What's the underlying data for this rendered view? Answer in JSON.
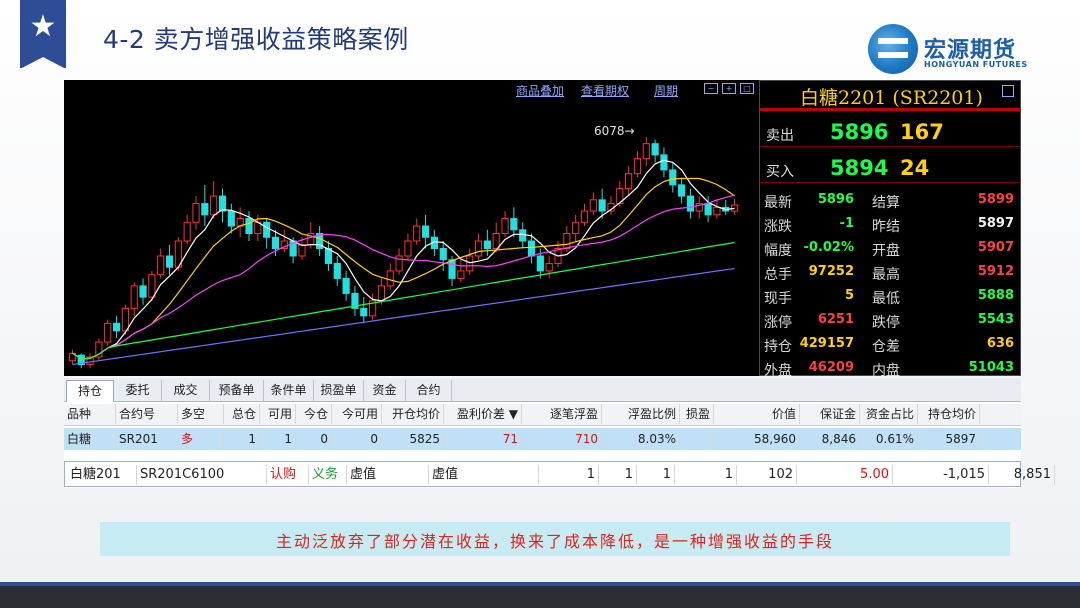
{
  "slide": {
    "title": "4-2 卖方增强收益策略案例",
    "logo_cn": "宏源期货",
    "logo_en": "HONGYUAN FUTURES",
    "note": "主动泛放弃了部分潜在收益，换来了成本降低，是一种增强收益的手段"
  },
  "toolbar": {
    "items": [
      "商品叠加",
      "查看期权",
      "周期"
    ]
  },
  "chart": {
    "peak_label": "6078→"
  },
  "chart_data": {
    "type": "candlestick",
    "annotations": [
      "6078"
    ],
    "ylim": [
      5450,
      6150
    ],
    "candles": [
      [
        5480,
        5500,
        5470,
        5510
      ],
      [
        5495,
        5470,
        5460,
        5500
      ],
      [
        5470,
        5490,
        5460,
        5500
      ],
      [
        5490,
        5530,
        5480,
        5540
      ],
      [
        5530,
        5580,
        5520,
        5590
      ],
      [
        5580,
        5560,
        5540,
        5600
      ],
      [
        5560,
        5620,
        5550,
        5630
      ],
      [
        5620,
        5680,
        5600,
        5690
      ],
      [
        5680,
        5650,
        5630,
        5700
      ],
      [
        5650,
        5710,
        5640,
        5720
      ],
      [
        5710,
        5760,
        5700,
        5780
      ],
      [
        5760,
        5730,
        5710,
        5790
      ],
      [
        5730,
        5800,
        5720,
        5810
      ],
      [
        5800,
        5850,
        5790,
        5870
      ],
      [
        5850,
        5900,
        5830,
        5920
      ],
      [
        5900,
        5870,
        5840,
        5950
      ],
      [
        5870,
        5920,
        5860,
        5960
      ],
      [
        5920,
        5880,
        5850,
        5940
      ],
      [
        5880,
        5840,
        5820,
        5900
      ],
      [
        5840,
        5860,
        5810,
        5890
      ],
      [
        5860,
        5820,
        5800,
        5880
      ],
      [
        5820,
        5850,
        5800,
        5870
      ],
      [
        5850,
        5810,
        5780,
        5860
      ],
      [
        5810,
        5780,
        5760,
        5830
      ],
      [
        5780,
        5800,
        5770,
        5830
      ],
      [
        5800,
        5760,
        5740,
        5810
      ],
      [
        5760,
        5790,
        5750,
        5810
      ],
      [
        5790,
        5820,
        5780,
        5850
      ],
      [
        5820,
        5780,
        5760,
        5840
      ],
      [
        5780,
        5740,
        5720,
        5800
      ],
      [
        5740,
        5700,
        5680,
        5760
      ],
      [
        5700,
        5660,
        5640,
        5720
      ],
      [
        5660,
        5620,
        5600,
        5680
      ],
      [
        5620,
        5600,
        5580,
        5650
      ],
      [
        5600,
        5640,
        5590,
        5660
      ],
      [
        5640,
        5680,
        5630,
        5700
      ],
      [
        5680,
        5720,
        5670,
        5740
      ],
      [
        5720,
        5760,
        5710,
        5780
      ],
      [
        5760,
        5800,
        5750,
        5820
      ],
      [
        5800,
        5840,
        5790,
        5860
      ],
      [
        5840,
        5810,
        5780,
        5870
      ],
      [
        5810,
        5780,
        5760,
        5830
      ],
      [
        5780,
        5750,
        5720,
        5800
      ],
      [
        5750,
        5700,
        5680,
        5760
      ],
      [
        5700,
        5720,
        5690,
        5750
      ],
      [
        5720,
        5760,
        5710,
        5780
      ],
      [
        5760,
        5800,
        5750,
        5820
      ],
      [
        5800,
        5780,
        5760,
        5830
      ],
      [
        5780,
        5820,
        5770,
        5850
      ],
      [
        5820,
        5860,
        5810,
        5880
      ],
      [
        5860,
        5830,
        5810,
        5890
      ],
      [
        5830,
        5800,
        5780,
        5850
      ],
      [
        5800,
        5760,
        5740,
        5820
      ],
      [
        5760,
        5720,
        5700,
        5780
      ],
      [
        5720,
        5740,
        5700,
        5760
      ],
      [
        5740,
        5780,
        5730,
        5800
      ],
      [
        5780,
        5820,
        5770,
        5840
      ],
      [
        5820,
        5850,
        5800,
        5870
      ],
      [
        5850,
        5880,
        5840,
        5900
      ],
      [
        5880,
        5910,
        5870,
        5930
      ],
      [
        5910,
        5880,
        5860,
        5940
      ],
      [
        5880,
        5900,
        5870,
        5920
      ],
      [
        5900,
        5940,
        5890,
        5960
      ],
      [
        5940,
        5980,
        5920,
        6000
      ],
      [
        5980,
        6020,
        5970,
        6040
      ],
      [
        6020,
        6060,
        6000,
        6078
      ],
      [
        6060,
        6030,
        6010,
        6070
      ],
      [
        6030,
        5990,
        5970,
        6050
      ],
      [
        5990,
        5950,
        5930,
        6010
      ],
      [
        5950,
        5920,
        5900,
        5970
      ],
      [
        5920,
        5880,
        5860,
        5940
      ],
      [
        5880,
        5900,
        5860,
        5920
      ],
      [
        5900,
        5870,
        5850,
        5920
      ],
      [
        5870,
        5890,
        5860,
        5910
      ],
      [
        5890,
        5880,
        5870,
        5910
      ],
      [
        5880,
        5896,
        5870,
        5912
      ]
    ],
    "ma": [
      {
        "name": "MA5",
        "color": "#ffffff"
      },
      {
        "name": "MA10",
        "color": "#ffd200"
      },
      {
        "name": "MA20",
        "color": "#ff40ff"
      },
      {
        "name": "MA60",
        "color": "#1aff4a"
      },
      {
        "name": "MA120",
        "color": "#7070ff"
      }
    ]
  },
  "quote": {
    "title": "白糖2201 (SR2201)",
    "sell_label": "卖出",
    "sell_price": "5896",
    "sell_vol": "167",
    "buy_label": "买入",
    "buy_price": "5894",
    "buy_vol": "24",
    "rows": [
      {
        "l1": "最新",
        "v1": "5896",
        "c1": "g",
        "l2": "结算",
        "v2": "5899",
        "c2": "r"
      },
      {
        "l1": "涨跌",
        "v1": "-1",
        "c1": "g",
        "l2": "昨结",
        "v2": "5897",
        "c2": "w"
      },
      {
        "l1": "幅度",
        "v1": "-0.02%",
        "c1": "g",
        "l2": "开盘",
        "v2": "5907",
        "c2": "r"
      },
      {
        "l1": "总手",
        "v1": "97252",
        "c1": "y",
        "l2": "最高",
        "v2": "5912",
        "c2": "r"
      },
      {
        "l1": "现手",
        "v1": "5",
        "c1": "y",
        "l2": "最低",
        "v2": "5888",
        "c2": "g"
      },
      {
        "l1": "涨停",
        "v1": "6251",
        "c1": "r",
        "l2": "跌停",
        "v2": "5543",
        "c2": "g"
      },
      {
        "l1": "持仓",
        "v1": "429157",
        "c1": "y",
        "l2": "仓差",
        "v2": "636",
        "c2": "y"
      },
      {
        "l1": "外盘",
        "v1": "46209",
        "c1": "r",
        "l2": "内盘",
        "v2": "51043",
        "c2": "g"
      }
    ]
  },
  "tabs": [
    "持仓",
    "委托",
    "成交",
    "预备单",
    "条件单",
    "损盈单",
    "资金",
    "合约"
  ],
  "table": {
    "headers": [
      "品种",
      "合约号",
      "多空",
      "总仓",
      "可用",
      "今仓",
      "今可用",
      "开仓均价",
      "盈利价差 ▼",
      "逐笔浮盈",
      "浮盈比例",
      "损盈",
      "价值",
      "保证金",
      "资金占比",
      "持仓均价"
    ],
    "row1": [
      "白糖",
      "SR201",
      "多",
      "1",
      "1",
      "0",
      "0",
      "5825",
      "71",
      "710",
      "8.03%",
      "",
      "58,960",
      "8,846",
      "0.61%",
      "5897"
    ],
    "row2": [
      "白糖201",
      "SR201C6100",
      "认购",
      "义务",
      "虚值",
      "虚值",
      "1",
      "1",
      "1",
      "1",
      "102",
      "5.00",
      "-1,015",
      "8,851"
    ]
  }
}
